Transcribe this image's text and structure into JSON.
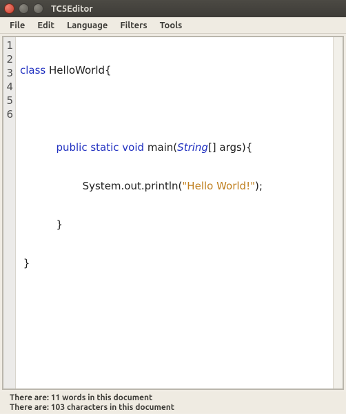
{
  "window": {
    "title": "TC5Editor"
  },
  "menu": {
    "file": "File",
    "edit": "Edit",
    "language": "Language",
    "filters": "Filters",
    "tools": "Tools"
  },
  "gutter": {
    "l1": "1",
    "l2": "2",
    "l3": "3",
    "l4": "4",
    "l5": "5",
    "l6": "6"
  },
  "code": {
    "line1": {
      "kw": "class",
      "rest": " HelloWorld{"
    },
    "line2": "",
    "line3": {
      "indent": "           ",
      "kw": "public static void",
      "mid": " main(",
      "type": "String",
      "rest": "[] args){"
    },
    "line4": {
      "indent": "                   ",
      "text1": "System.out.println(",
      "str": "\"Hello World!\"",
      "text2": ");"
    },
    "line5": "           }",
    "line6": " }"
  },
  "status": {
    "words": "There are: 11 words in this document",
    "chars": "There are: 103 characters in this document"
  }
}
